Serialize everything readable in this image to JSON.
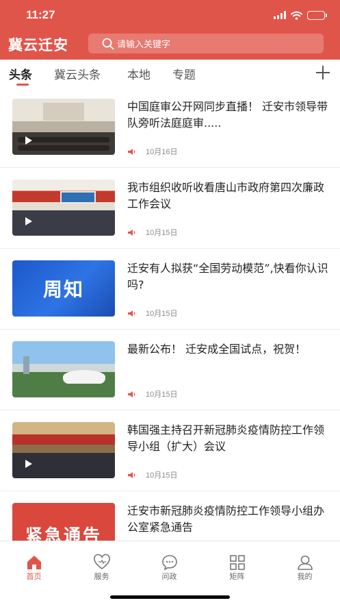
{
  "status_bar": {
    "time": "11:27",
    "icons": [
      "signal-icon",
      "wifi-icon",
      "battery-charging-icon"
    ]
  },
  "app_bar": {
    "title": "冀云迁安",
    "search_placeholder": "请输入关键字"
  },
  "tabs": [
    {
      "label": "头条",
      "active": true
    },
    {
      "label": "冀云头条",
      "active": false
    },
    {
      "label": "本地",
      "active": false
    },
    {
      "label": "专题",
      "active": false
    }
  ],
  "news": [
    {
      "title": "中国庭审公开网同步直播！ 迁安市领导带队旁听法庭庭审.....",
      "date": "10月16日",
      "video": true
    },
    {
      "title": "我市组织收听收看唐山市政府第四次廉政工作会议",
      "date": "10月15日",
      "video": true
    },
    {
      "title": "迁安有人拟获“全国劳动模范”,快看你认识吗?",
      "date": "10月15日",
      "video": false,
      "thumb_text": "周知"
    },
    {
      "title": "最新公布！ 迁安成全国试点，祝贺！",
      "date": "10月15日",
      "video": false
    },
    {
      "title": "韩国强主持召开新冠肺炎疫情防控工作领导小组（扩大）会议",
      "date": "10月15日",
      "video": true
    },
    {
      "title": "迁安市新冠肺炎疫情防控工作领导小组办公室紧急通告",
      "date": "",
      "video": false,
      "thumb_text": "紧急通告"
    }
  ],
  "bottom_nav": [
    {
      "label": "首页",
      "icon": "home-icon",
      "active": true
    },
    {
      "label": "服务",
      "icon": "heart-icon",
      "active": false
    },
    {
      "label": "问政",
      "icon": "chat-bubble-icon",
      "active": false
    },
    {
      "label": "矩阵",
      "icon": "grid-icon",
      "active": false
    },
    {
      "label": "我的",
      "icon": "user-icon",
      "active": false
    }
  ],
  "colors": {
    "brand": "#e0554a",
    "text": "#222222",
    "muted": "#8a8a8a"
  }
}
